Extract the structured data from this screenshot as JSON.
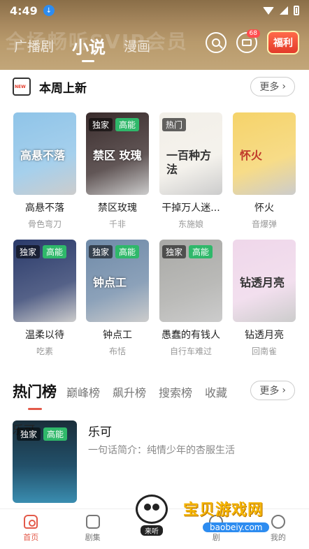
{
  "status": {
    "time": "4:49"
  },
  "banner_faded_text": "全场畅听SVIP会员",
  "header": {
    "tabs": [
      {
        "label": "广播剧",
        "active": false
      },
      {
        "label": "小说",
        "active": true
      },
      {
        "label": "漫画",
        "active": false
      }
    ],
    "mail_badge": "68",
    "gift_label": "福利"
  },
  "weekly": {
    "title": "本周上新",
    "more_label": "更多",
    "books": [
      {
        "name": "高悬不落",
        "author": "骨色弯刀",
        "tags": [],
        "cover_text": "高悬不落",
        "cover_color": "#8fc4e8"
      },
      {
        "name": "禁区玫瑰",
        "author": "千非",
        "tags": [
          "独家",
          "高能"
        ],
        "cover_text": "禁区 玫瑰",
        "cover_color": "#3a2c2c"
      },
      {
        "name": "干掉万人迷...",
        "author": "东施娘",
        "tags": [
          "热门"
        ],
        "cover_text": "一百种方法",
        "cover_color": "#f2efe8"
      },
      {
        "name": "怀火",
        "author": "音爆弹",
        "tags": [],
        "cover_text": "怀火",
        "cover_color": "#f5d36a"
      },
      {
        "name": "温柔以待",
        "author": "吃素",
        "tags": [
          "独家",
          "高能"
        ],
        "cover_text": "",
        "cover_color": "#2a3a6a"
      },
      {
        "name": "钟点工",
        "author": "布恬",
        "tags": [
          "独家",
          "高能"
        ],
        "cover_text": "钟点工",
        "cover_color": "#6f8aa8"
      },
      {
        "name": "愚蠢的有钱人",
        "author": "自行车难过",
        "tags": [
          "独家",
          "高能"
        ],
        "cover_text": "",
        "cover_color": "#a9a9a6"
      },
      {
        "name": "钻透月亮",
        "author": "回南雀",
        "tags": [],
        "cover_text": "钻透月亮",
        "cover_color": "#efd7ea"
      }
    ]
  },
  "ranking": {
    "tabs": [
      {
        "label": "热门榜",
        "active": true
      },
      {
        "label": "巅峰榜",
        "active": false
      },
      {
        "label": "飙升榜",
        "active": false
      },
      {
        "label": "搜索榜",
        "active": false
      },
      {
        "label": "收藏",
        "active": false
      }
    ],
    "more_label": "更多",
    "featured": {
      "title": "乐可",
      "desc": "一句话简介：纯情少年的杏服生活",
      "tags": [
        "独家",
        "高能"
      ],
      "cover_text": "乐可"
    }
  },
  "bottom_nav": {
    "items": [
      {
        "label": "首页",
        "active": true
      },
      {
        "label": "剧集",
        "active": false
      },
      {
        "label": "",
        "active": false
      },
      {
        "label": "剧",
        "active": false
      },
      {
        "label": "我的",
        "active": false
      }
    ],
    "listen_label": "来听"
  },
  "watermark": {
    "title": "宝贝游戏网",
    "url": "baobeiy.com"
  },
  "colors": {
    "accent": "#e35a4a",
    "tag_green": "#2fb86a",
    "banner": "#a8895f"
  }
}
